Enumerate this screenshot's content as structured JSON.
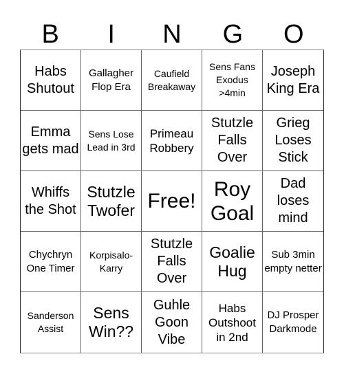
{
  "header": {
    "letters": [
      "B",
      "I",
      "N",
      "G",
      "O"
    ]
  },
  "cells": [
    {
      "text": "Habs Shutout",
      "size": "s20"
    },
    {
      "text": "Gallagher Flop Era",
      "size": "s15"
    },
    {
      "text": "Caufield Breakaway",
      "size": "s13"
    },
    {
      "text": "Sens Fans Exodus >4min",
      "size": "s13"
    },
    {
      "text": "Joseph King Era",
      "size": "s20"
    },
    {
      "text": "Emma gets mad",
      "size": "s20"
    },
    {
      "text": "Sens Lose Lead in 3rd",
      "size": "s13"
    },
    {
      "text": "Primeau Robbery",
      "size": "s17"
    },
    {
      "text": "Stutzle Falls Over",
      "size": "s20"
    },
    {
      "text": "Grieg Loses Stick",
      "size": "s20"
    },
    {
      "text": "Whiffs the Shot",
      "size": "s20"
    },
    {
      "text": "Stutzle Twofer",
      "size": "s23"
    },
    {
      "text": "Free!",
      "size": "s28"
    },
    {
      "text": "Roy Goal",
      "size": "s28"
    },
    {
      "text": "Dad loses mind",
      "size": "s20"
    },
    {
      "text": "Chychryn One Timer",
      "size": "s15"
    },
    {
      "text": "Korpisalo-Karry",
      "size": "s13"
    },
    {
      "text": "Stutzle Falls Over",
      "size": "s20"
    },
    {
      "text": "Goalie Hug",
      "size": "s23"
    },
    {
      "text": "Sub 3min empty netter",
      "size": "s15"
    },
    {
      "text": "Sanderson Assist",
      "size": "s13"
    },
    {
      "text": "Sens Win??",
      "size": "s23"
    },
    {
      "text": "Guhle Goon Vibe",
      "size": "s20"
    },
    {
      "text": "Habs Outshoot in 2nd",
      "size": "s17"
    },
    {
      "text": "DJ Prosper Darkmode",
      "size": "s15"
    }
  ]
}
